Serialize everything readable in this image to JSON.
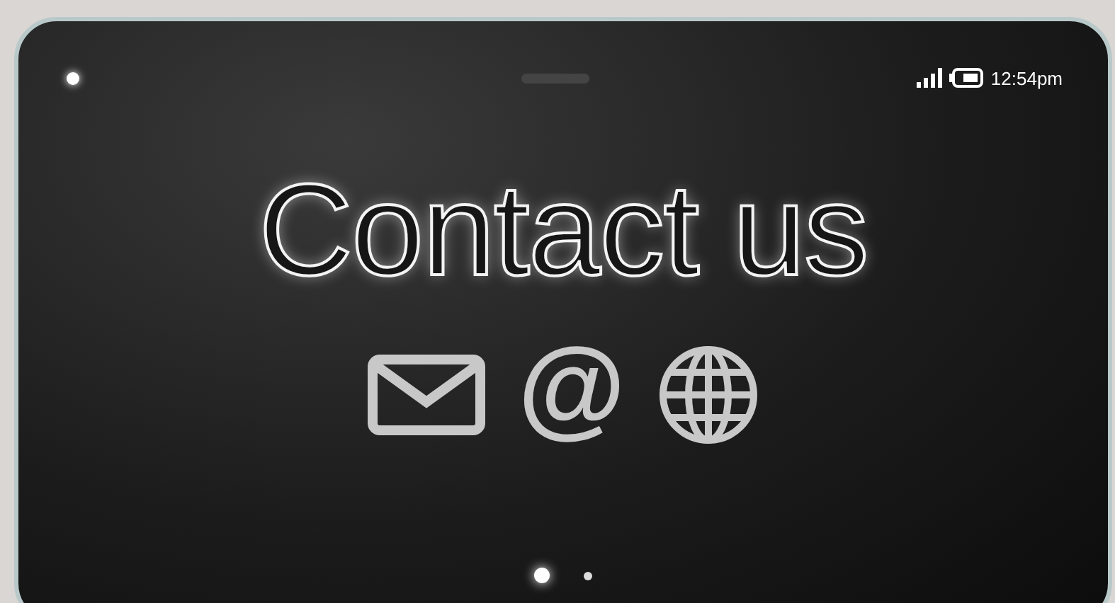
{
  "status_bar": {
    "time": "12:54pm"
  },
  "title": "Contact us",
  "contact_icons": [
    {
      "kind": "envelope"
    },
    {
      "kind": "text",
      "text": "@"
    },
    {
      "kind": "globe"
    }
  ],
  "pager": [
    {
      "selected": true
    },
    {
      "selected": false
    }
  ]
}
